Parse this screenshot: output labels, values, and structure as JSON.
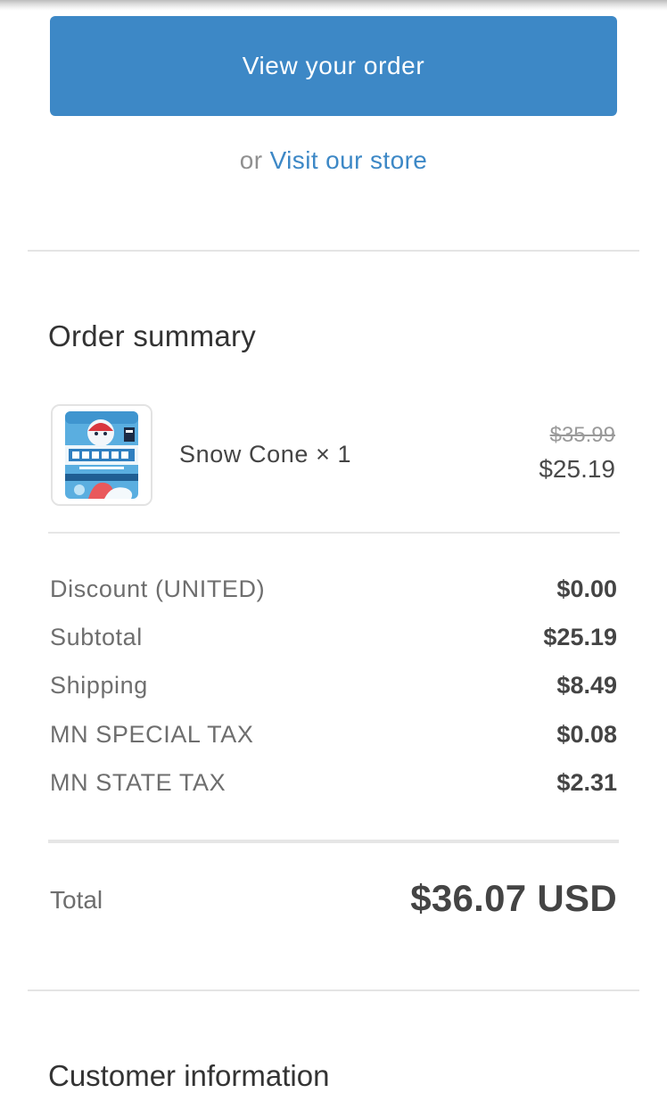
{
  "actions": {
    "view_order_label": "View your order",
    "or_text": "or",
    "visit_store_label": "Visit our store"
  },
  "order_summary": {
    "title": "Order summary",
    "items": [
      {
        "name": "Snow Cone × 1",
        "original_price": "$35.99",
        "price": "$25.19",
        "thumbnail_brand": "G FUEL"
      }
    ],
    "lines": [
      {
        "label": "Discount (UNITED)",
        "value": "$0.00"
      },
      {
        "label": "Subtotal",
        "value": "$25.19"
      },
      {
        "label": "Shipping",
        "value": "$8.49"
      },
      {
        "label": "MN SPECIAL TAX",
        "value": "$0.08"
      },
      {
        "label": "MN STATE TAX",
        "value": "$2.31"
      }
    ],
    "total_label": "Total",
    "total_value": "$36.07 USD"
  },
  "next_section": {
    "title": "Customer information"
  },
  "colors": {
    "accent": "#3d88c6",
    "text": "#333333",
    "muted": "#6e6e6e",
    "divider": "#e4e4e4"
  },
  "icons": {
    "product_thumbnail": "gfuel-snow-cone-tub-image"
  }
}
